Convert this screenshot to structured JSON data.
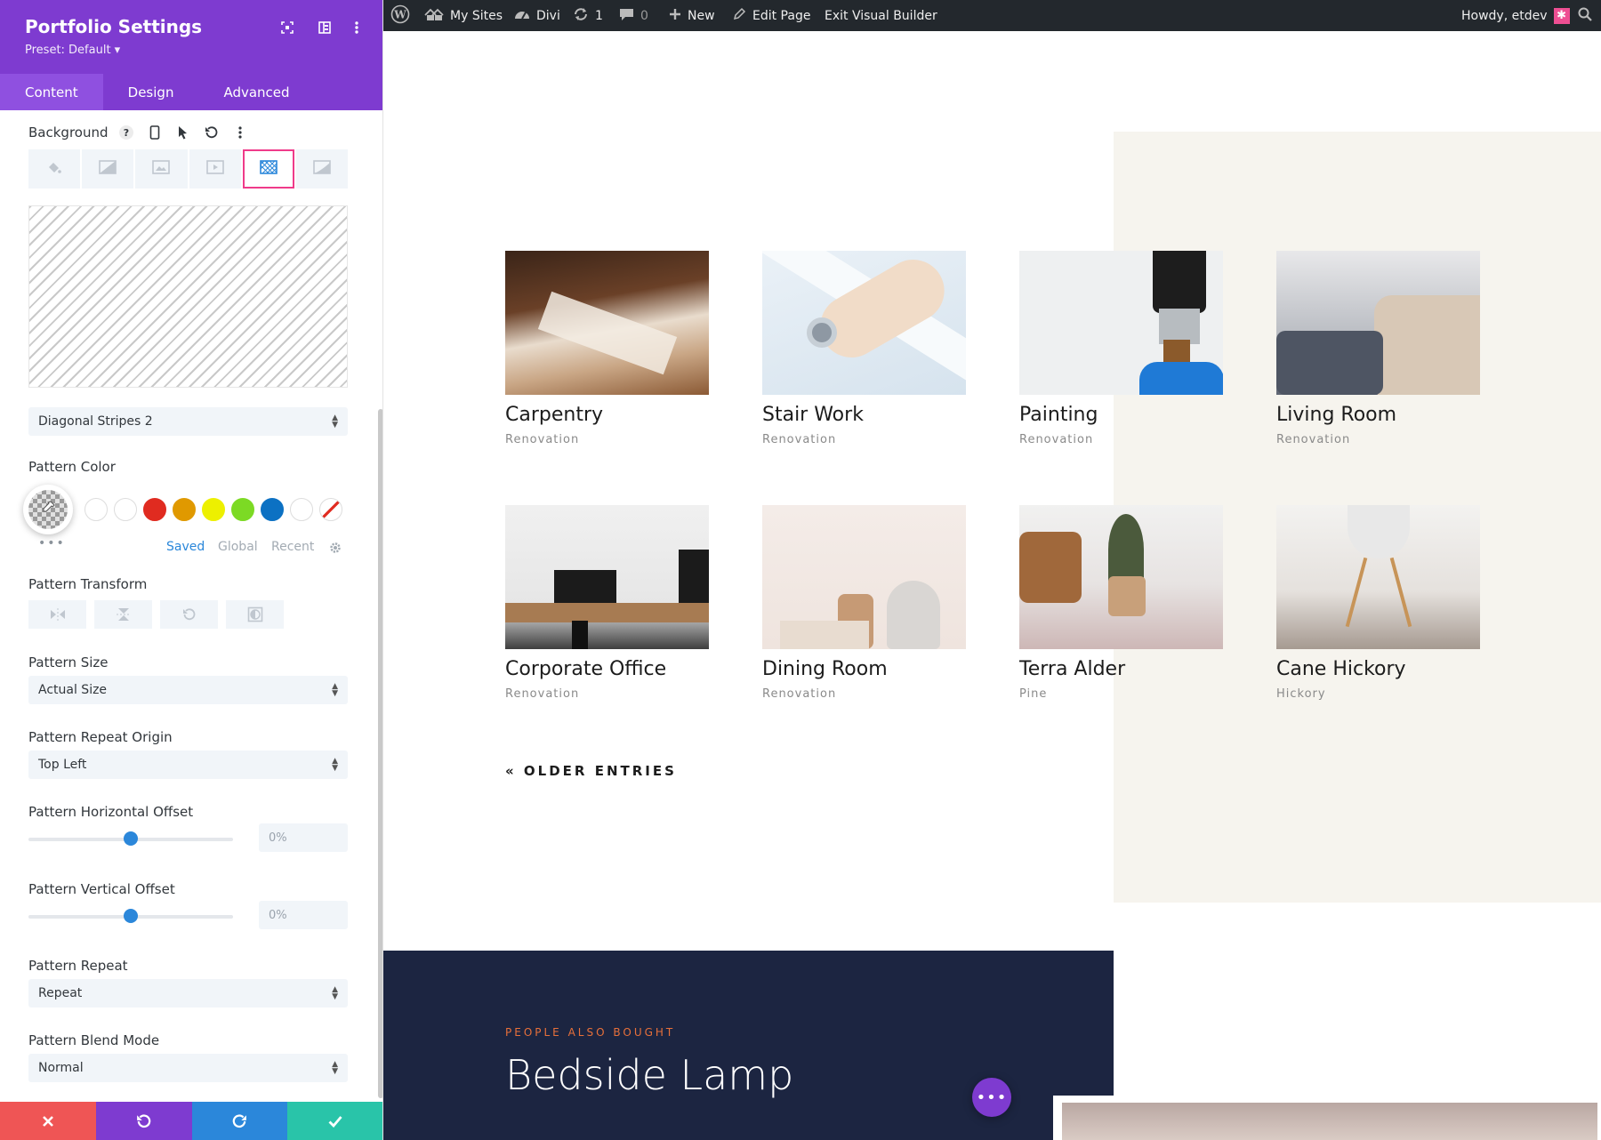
{
  "panel": {
    "title": "Portfolio Settings",
    "preset": "Preset: Default ▾",
    "tabs": [
      "Content",
      "Design",
      "Advanced"
    ],
    "accent": "#7e3bd0",
    "background": {
      "label": "Background",
      "help": "?"
    },
    "pattern_style": "Diagonal Stripes 2",
    "pattern_color": {
      "label": "Pattern Color",
      "swatches": [
        "#ffffff",
        "#ffffff",
        "#e02b20",
        "#e09900",
        "#edf000",
        "#7cda24",
        "#0c71c3",
        "#ffffff",
        "none"
      ],
      "more": "•••",
      "tab_saved": "Saved",
      "tab_global": "Global",
      "tab_recent": "Recent"
    },
    "pattern_transform": {
      "label": "Pattern Transform"
    },
    "pattern_size": {
      "label": "Pattern Size",
      "value": "Actual Size"
    },
    "pattern_repeat_origin": {
      "label": "Pattern Repeat Origin",
      "value": "Top Left"
    },
    "horizontal_offset": {
      "label": "Pattern Horizontal Offset",
      "value": "0%",
      "slider_fraction": 0.5
    },
    "vertical_offset": {
      "label": "Pattern Vertical Offset",
      "value": "0%",
      "slider_fraction": 0.5
    },
    "pattern_repeat": {
      "label": "Pattern Repeat",
      "value": "Repeat"
    },
    "pattern_blend_mode": {
      "label": "Pattern Blend Mode",
      "value": "Normal"
    },
    "footer_colors": [
      "#ef5555",
      "#7e3bd0",
      "#2b87da",
      "#29c4a9"
    ]
  },
  "adminbar": {
    "my_sites": "My Sites",
    "divi": "Divi",
    "updates": "1",
    "comments": "0",
    "new": "New",
    "edit_page": "Edit Page",
    "exit_builder": "Exit Visual Builder",
    "howdy": "Howdy, etdev"
  },
  "portfolio": {
    "items": [
      {
        "title": "Carpentry",
        "category": "Renovation"
      },
      {
        "title": "Stair Work",
        "category": "Renovation"
      },
      {
        "title": "Painting",
        "category": "Renovation"
      },
      {
        "title": "Living Room",
        "category": "Renovation"
      },
      {
        "title": "Corporate Office",
        "category": "Renovation"
      },
      {
        "title": "Dining Room",
        "category": "Renovation"
      },
      {
        "title": "Terra Alder",
        "category": "Pine"
      },
      {
        "title": "Cane Hickory",
        "category": "Hickory"
      }
    ],
    "older_entries": "« OLDER ENTRIES"
  },
  "promo": {
    "eyebrow": "PEOPLE ALSO BOUGHT",
    "title": "Bedside Lamp"
  },
  "fab": "•••"
}
